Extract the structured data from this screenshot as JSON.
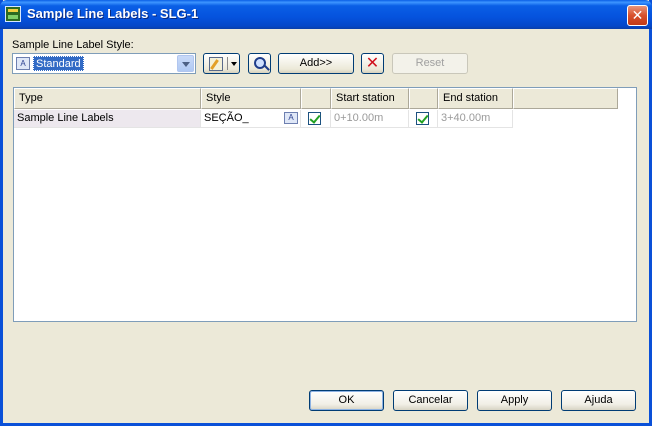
{
  "window": {
    "title": "Sample Line Labels - SLG-1",
    "close_glyph": "✕"
  },
  "style_section": {
    "label": "Sample Line Label Style:",
    "selected_style": "Standard",
    "style_icon_glyph": "A"
  },
  "toolbar": {
    "add_label": "Add>>",
    "delete_glyph": "✕",
    "reset_label": "Reset"
  },
  "grid": {
    "columns": [
      "Type",
      "Style",
      "",
      "Start station",
      "",
      "End station",
      ""
    ],
    "rows": [
      {
        "type": "Sample Line Labels",
        "style": "SEÇÃO_",
        "style_icon_glyph": "A",
        "start_checked": true,
        "start_station": "0+10.00m",
        "end_checked": true,
        "end_station": "3+40.00m"
      }
    ]
  },
  "buttons": {
    "ok": "OK",
    "cancel": "Cancelar",
    "apply": "Apply",
    "help": "Ajuda"
  },
  "colors": {
    "titlebar": "#0552dd",
    "selection": "#316ac5",
    "close": "#d8502c",
    "check": "#21a121"
  }
}
